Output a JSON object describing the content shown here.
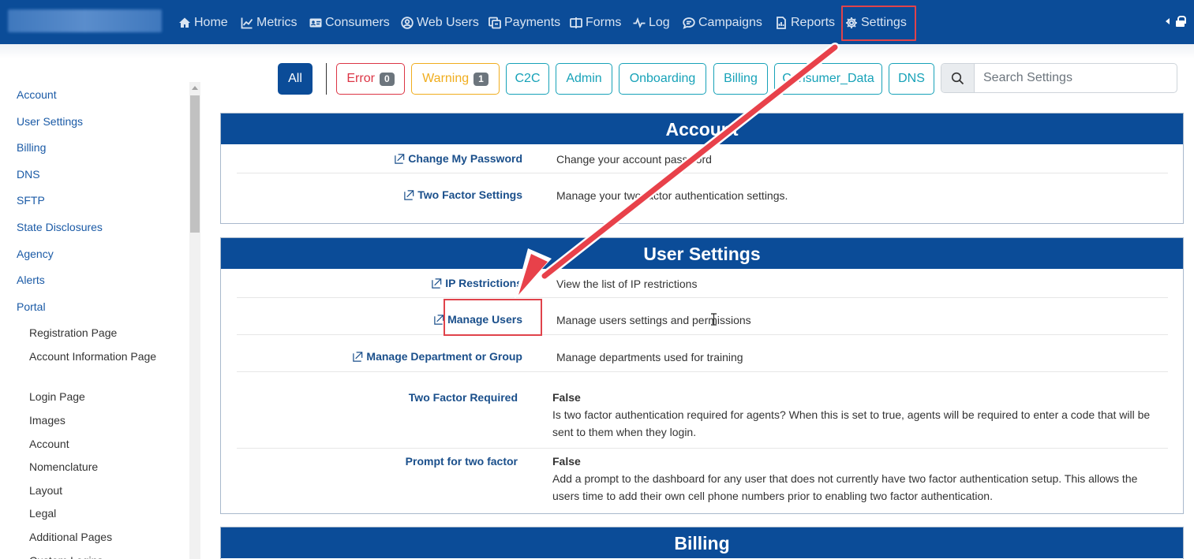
{
  "nav": {
    "items": [
      {
        "label": "Home",
        "icon": "home-icon"
      },
      {
        "label": "Metrics",
        "icon": "chart-icon"
      },
      {
        "label": "Consumers",
        "icon": "id-card-icon"
      },
      {
        "label": "Web Users",
        "icon": "user-circle-icon"
      },
      {
        "label": "Payments",
        "icon": "payments-icon"
      },
      {
        "label": "Forms",
        "icon": "forms-icon"
      },
      {
        "label": "Log",
        "icon": "pulse-icon"
      },
      {
        "label": "Campaigns",
        "icon": "chat-icon"
      },
      {
        "label": "Reports",
        "icon": "report-icon"
      },
      {
        "label": "Settings",
        "icon": "gear-icon"
      }
    ],
    "right_icons": [
      "caret-left-icon",
      "lock-icon"
    ]
  },
  "sidebar": {
    "items": [
      "Account",
      "User Settings",
      "Billing",
      "DNS",
      "SFTP",
      "State Disclosures",
      "Agency",
      "Alerts",
      "Portal"
    ],
    "sub_items": [
      "Registration Page",
      "Account Information Page",
      "Login Page",
      "Images",
      "Account",
      "Nomenclature",
      "Layout",
      "Legal",
      "Additional Pages",
      "Custom Logins"
    ]
  },
  "filters": {
    "all": "All",
    "error": {
      "label": "Error",
      "count": "0"
    },
    "warning": {
      "label": "Warning",
      "count": "1"
    },
    "tags": [
      "C2C",
      "Admin",
      "Onboarding",
      "Billing",
      "Consumer_Data",
      "DNS"
    ],
    "search_placeholder": "Search Settings"
  },
  "colors": {
    "nav_bg": "#0b4c98",
    "error": "#dc3545",
    "warning": "#f0ad1e",
    "info": "#17a2b8",
    "annotation": "#e0434b"
  },
  "sections": {
    "account": {
      "title": "Account",
      "rows": [
        {
          "link": "Change My Password",
          "desc": "Change your account password"
        },
        {
          "link": "Two Factor Settings",
          "desc": "Manage your two factor authentication settings."
        }
      ]
    },
    "user_settings": {
      "title": "User Settings",
      "rows": [
        {
          "link": "IP Restrictions",
          "desc": "View the list of IP restrictions"
        },
        {
          "link": "Manage Users",
          "desc": "Manage users settings and permissions"
        },
        {
          "link": "Manage Department or Group",
          "desc": "Manage departments used for training"
        }
      ],
      "settings": [
        {
          "label": "Two Factor Required",
          "value": "False",
          "desc": "Is two factor authentication required for agents? When this is set to true, agents will be required to enter a code that will be sent to them when they login."
        },
        {
          "label": "Prompt for two factor",
          "value": "False",
          "desc": "Add a prompt to the dashboard for any user that does not currently have two factor authentication setup. This allows the users time to add their own cell phone numbers prior to enabling two factor authentication."
        }
      ]
    },
    "billing": {
      "title": "Billing"
    }
  }
}
